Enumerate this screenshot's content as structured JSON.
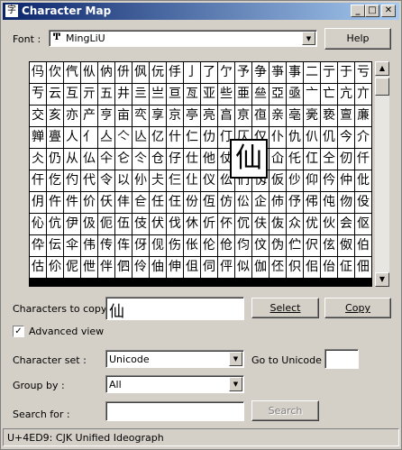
{
  "window": {
    "title": "Character Map"
  },
  "font_row": {
    "label": "Font :",
    "value": "MingLiU",
    "type_icon": "truetype-icon",
    "help_button": "Help"
  },
  "grid": {
    "rows": [
      [
        "㐷",
        "㐸",
        "㐹",
        "㐺",
        "㐻",
        "㐼",
        "㐽",
        "㐾",
        "㐿",
        "亅",
        "了",
        "亇",
        "予",
        "争",
        "亊",
        "事",
        "二",
        "亍",
        "于",
        "亏"
      ],
      [
        "亐",
        "云",
        "互",
        "亓",
        "五",
        "井",
        "亖",
        "亗",
        "亘",
        "亙",
        "亚",
        "些",
        "亜",
        "亝",
        "亞",
        "亟",
        "亠",
        "亡",
        "亢",
        "亣"
      ],
      [
        "交",
        "亥",
        "亦",
        "产",
        "亨",
        "亩",
        "亪",
        "享",
        "京",
        "亭",
        "亮",
        "亯",
        "亰",
        "亱",
        "亲",
        "亳",
        "亴",
        "亵",
        "亶",
        "亷"
      ],
      [
        "亸",
        "亹",
        "人",
        "亻",
        "亼",
        "亽",
        "亾",
        "亿",
        "什",
        "仁",
        "仂",
        "仃",
        "仄",
        "仅",
        "仆",
        "仇",
        "仈",
        "仉",
        "今",
        "介"
      ],
      [
        "仌",
        "仍",
        "从",
        "仏",
        "仐",
        "仑",
        "仒",
        "仓",
        "仔",
        "仕",
        "他",
        "仗",
        "付",
        "仙",
        "仚",
        "仛",
        "仜",
        "仝",
        "仞",
        "仟"
      ],
      [
        "仠",
        "仡",
        "仢",
        "代",
        "令",
        "以",
        "仦",
        "仧",
        "仨",
        "仩",
        "仪",
        "仫",
        "们",
        "仭",
        "仮",
        "仯",
        "仰",
        "仱",
        "仲",
        "仳"
      ],
      [
        "仴",
        "仵",
        "件",
        "价",
        "仸",
        "仹",
        "仺",
        "任",
        "仼",
        "份",
        "仾",
        "仿",
        "伀",
        "企",
        "伂",
        "伃",
        "伄",
        "伅",
        "伆",
        "伇"
      ],
      [
        "伈",
        "伉",
        "伊",
        "伋",
        "伌",
        "伍",
        "伎",
        "伏",
        "伐",
        "休",
        "伒",
        "伓",
        "伔",
        "伕",
        "伖",
        "众",
        "优",
        "伙",
        "会",
        "伛"
      ],
      [
        "伜",
        "伝",
        "伞",
        "伟",
        "传",
        "伡",
        "伢",
        "伣",
        "伤",
        "伥",
        "伦",
        "伧",
        "伨",
        "伩",
        "伪",
        "伫",
        "伬",
        "伭",
        "伮",
        "伯"
      ],
      [
        "估",
        "伱",
        "伲",
        "伳",
        "伴",
        "伵",
        "伶",
        "伷",
        "伸",
        "伹",
        "伺",
        "伻",
        "似",
        "伽",
        "伾",
        "伿",
        "佀",
        "佁",
        "佂",
        "佃"
      ]
    ],
    "zoomed_char": "仙"
  },
  "copy_row": {
    "label": "Characters to copy :",
    "value": "仙",
    "select_button": "Select",
    "copy_button": "Copy"
  },
  "advanced": {
    "label": "Advanced view",
    "checked": true
  },
  "charset": {
    "label": "Character set :",
    "value": "Unicode",
    "goto_label": "Go to Unicode :",
    "goto_value": ""
  },
  "groupby": {
    "label": "Group by :",
    "value": "All"
  },
  "search": {
    "label": "Search for :",
    "value": "",
    "button": "Search"
  },
  "status": {
    "text": "U+4ED9: CJK Unified Ideograph"
  }
}
